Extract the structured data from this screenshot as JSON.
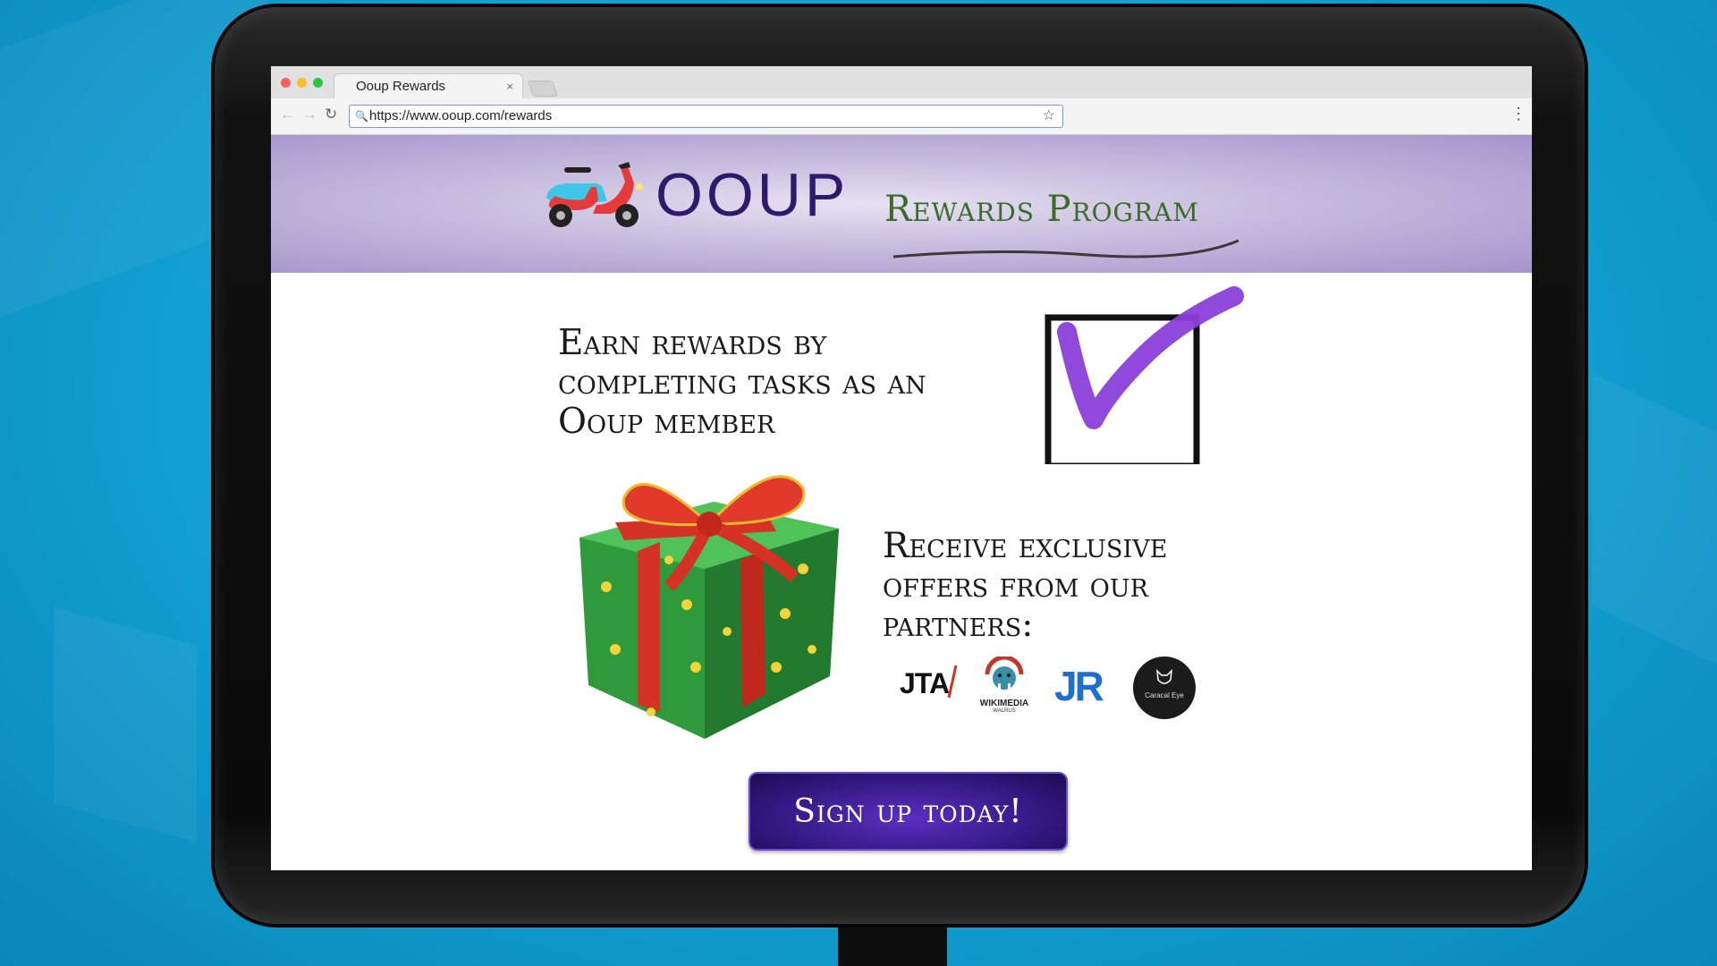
{
  "browser": {
    "tab_title": "Ooup Rewards",
    "tab_close": "×",
    "url": "https://www.ooup.com/rewards",
    "nav": {
      "back": "←",
      "forward": "→",
      "reload": "↻"
    },
    "menu_glyph": "⋮",
    "bookmark_glyph": "☆",
    "search_glyph": "🔍"
  },
  "header": {
    "brand": "OOUP",
    "subtitle": "Rewards Program",
    "logo_icon": "scooter-icon"
  },
  "main": {
    "earn_lines": [
      "Earn rewards by",
      "completing tasks as an",
      "Ooup member"
    ],
    "receive_lines": [
      "Receive exclusive",
      "offers from our",
      "partners:"
    ],
    "signup_label": "Sign up today!",
    "partners": [
      {
        "name": "JTA",
        "icon": "jta-logo"
      },
      {
        "name": "WIKIMEDIA",
        "sub": "WALRUS",
        "icon": "wikimedia-walrus-logo"
      },
      {
        "name": "JR",
        "icon": "jr-logo"
      },
      {
        "name": "Caracal Eye",
        "icon": "caracal-eye-logo"
      }
    ]
  },
  "colors": {
    "header_accent": "#a395cb",
    "brand_text": "#2a1b6b",
    "subtitle_text": "#3b6a2b",
    "check_mark": "#8a3fd8",
    "button_bg": "#2d1577",
    "background": "#11a0d2"
  }
}
